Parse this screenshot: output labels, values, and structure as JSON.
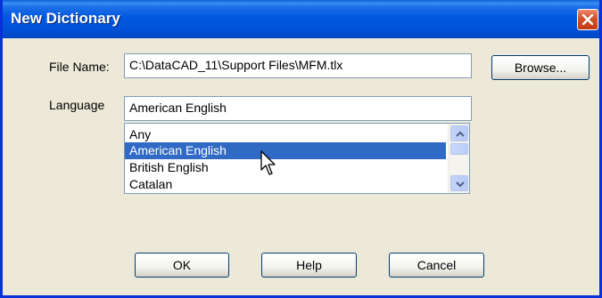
{
  "window": {
    "title": "New Dictionary"
  },
  "file_name": {
    "label": "File Name:",
    "value": "C:\\DataCAD_11\\Support Files\\MFM.tlx",
    "browse_label": "Browse..."
  },
  "language": {
    "label": "Language",
    "value": "American English",
    "options": [
      "Any",
      "American English",
      "British English",
      "Catalan"
    ],
    "selected": "American English"
  },
  "buttons": {
    "ok": "OK",
    "help": "Help",
    "cancel": "Cancel"
  },
  "icons": {
    "close": "close-icon",
    "scroll_up": "chevron-up-icon",
    "scroll_down": "chevron-down-icon",
    "cursor": "mouse-pointer-icon"
  },
  "colors": {
    "titlebar": "#0054e3",
    "selection": "#316ac5",
    "close_button": "#d4512b",
    "dialog_bg": "#ece9d8"
  }
}
